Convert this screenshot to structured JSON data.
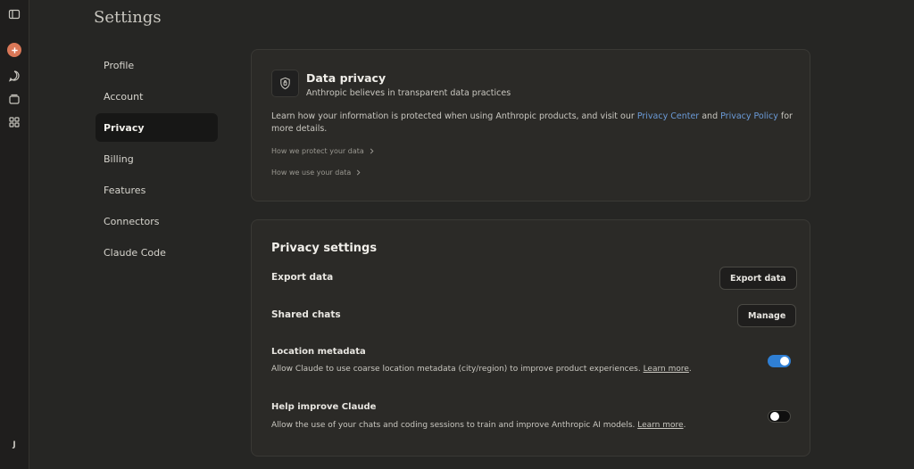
{
  "settings": {
    "title": "Settings"
  },
  "sidebar": {
    "user_initial": "J",
    "icons": [
      "sidebar-toggle-icon",
      "new-chat-icon",
      "chats-icon",
      "projects-icon",
      "artifacts-icon"
    ]
  },
  "nav": {
    "items": [
      {
        "label": "Profile"
      },
      {
        "label": "Account"
      },
      {
        "label": "Privacy",
        "active": true
      },
      {
        "label": "Billing"
      },
      {
        "label": "Features"
      },
      {
        "label": "Connectors"
      },
      {
        "label": "Claude Code"
      }
    ]
  },
  "data_privacy": {
    "title": "Data privacy",
    "subtitle": "Anthropic believes in transparent data practices",
    "desc_pre": "Learn how your information is protected when using Anthropic products, and visit our ",
    "privacy_center": "Privacy Center",
    "and": " and ",
    "privacy_policy": "Privacy Policy",
    "desc_post": " for more details.",
    "link_protect": "How we protect your data",
    "link_use": "How we use your data"
  },
  "privacy_settings": {
    "title": "Privacy settings",
    "export_label": "Export data",
    "export_button": "Export data",
    "shared_label": "Shared chats",
    "manage_button": "Manage",
    "location_label": "Location metadata",
    "location_desc": "Allow Claude to use coarse location metadata (city/region) to improve product experiences. ",
    "location_enabled": true,
    "help_label": "Help improve Claude",
    "help_desc": "Allow the use of your chats and coding sessions to train and improve Anthropic AI models. ",
    "help_enabled": false,
    "learn_more": "Learn more",
    "period": "."
  },
  "colors": {
    "accent": "#d97757",
    "link": "#6b9bd8",
    "toggle_on": "#2f7fd4"
  }
}
